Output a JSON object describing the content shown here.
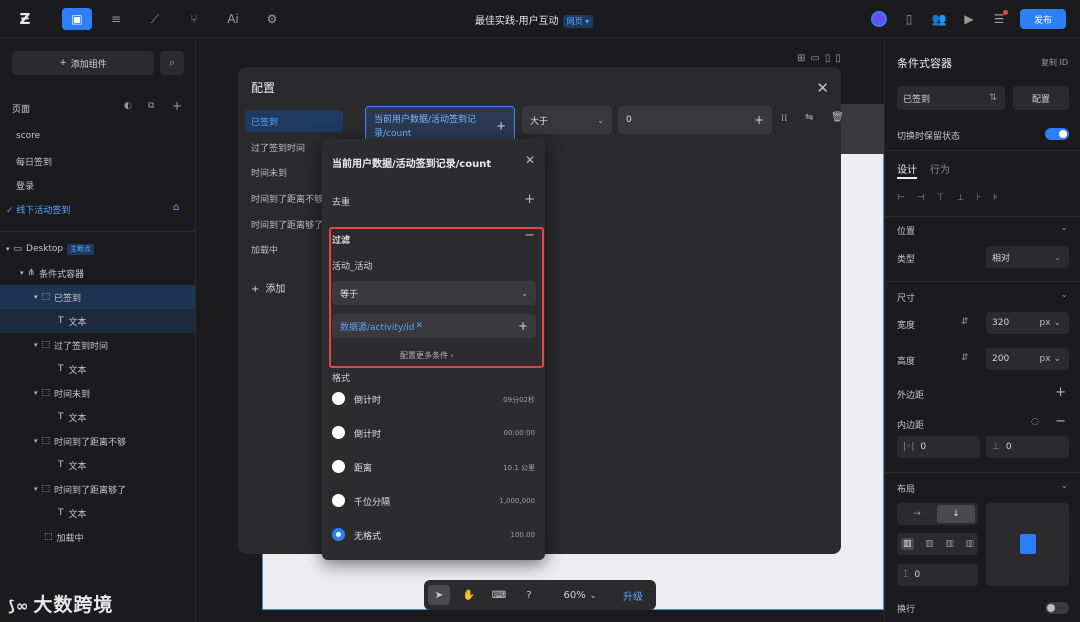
{
  "topbar": {
    "title": "最佳实践-用户互动",
    "page_type_tag": "网页 ▾",
    "ai_label": "Ai",
    "publish_label": "发布"
  },
  "left_panel": {
    "add_component_label": "添加组件",
    "pages_label": "页面",
    "pages": [
      "score",
      "每日签到",
      "登录",
      "线下活动签到"
    ],
    "tree": {
      "root": "Desktop",
      "root_badge": "主断点",
      "container": "条件式容器",
      "states": [
        {
          "label": "已签到",
          "child": "文本"
        },
        {
          "label": "过了签到时间",
          "child": "文本"
        },
        {
          "label": "时间未到",
          "child": "文本"
        },
        {
          "label": "时间到了距离不够",
          "child": "文本"
        },
        {
          "label": "时间到了距离够了",
          "child": "文本"
        },
        {
          "label": "加载中",
          "child": ""
        }
      ]
    }
  },
  "dialog": {
    "title": "配置",
    "list": [
      "已签到",
      "过了签到时间",
      "时间未到",
      "时间到了距离不够",
      "时间到了距离够了",
      "加载中"
    ],
    "add_label": "添加",
    "condition": {
      "field": "当前用户数据/活动签到记录/count",
      "operator": "大于",
      "value": "0"
    }
  },
  "popover": {
    "title": "当前用户数据/活动签到记录/count",
    "dedupe_label": "去重",
    "filter_label": "过滤",
    "filter_field": "活动_活动",
    "filter_operator": "等于",
    "filter_value": "数据源/activity/id",
    "more_conditions": "配置更多条件",
    "format_label": "格式",
    "formats": [
      {
        "name": "倒计时",
        "example": "09分02秒",
        "selected": false
      },
      {
        "name": "倒计时",
        "example": "00:00:00",
        "selected": false
      },
      {
        "name": "距离",
        "example": "10.1 公里",
        "selected": false
      },
      {
        "name": "千位分隔",
        "example": "1,000,000",
        "selected": false
      },
      {
        "name": "无格式",
        "example": "100.00",
        "selected": true
      }
    ]
  },
  "right_panel": {
    "title": "条件式容器",
    "copy_id": "复制 ID",
    "state_select": "已签到",
    "config_button": "配置",
    "keep_state_label": "切换时保留状态",
    "tabs": [
      "设计",
      "行为"
    ],
    "position_label": "位置",
    "type_label": "类型",
    "type_value": "相对",
    "size_label": "尺寸",
    "width_label": "宽度",
    "width_value": "320",
    "width_unit": "px",
    "height_label": "高度",
    "height_value": "200",
    "height_unit": "px",
    "margin_label": "外边距",
    "padding_label": "内边距",
    "padding_x": "0",
    "padding_y": "0",
    "layout_label": "布局",
    "gap_value": "0",
    "wrap_label": "换行"
  },
  "bottom_toolbar": {
    "zoom": "60%",
    "upgrade": "升级"
  },
  "watermark": "大数跨境"
}
